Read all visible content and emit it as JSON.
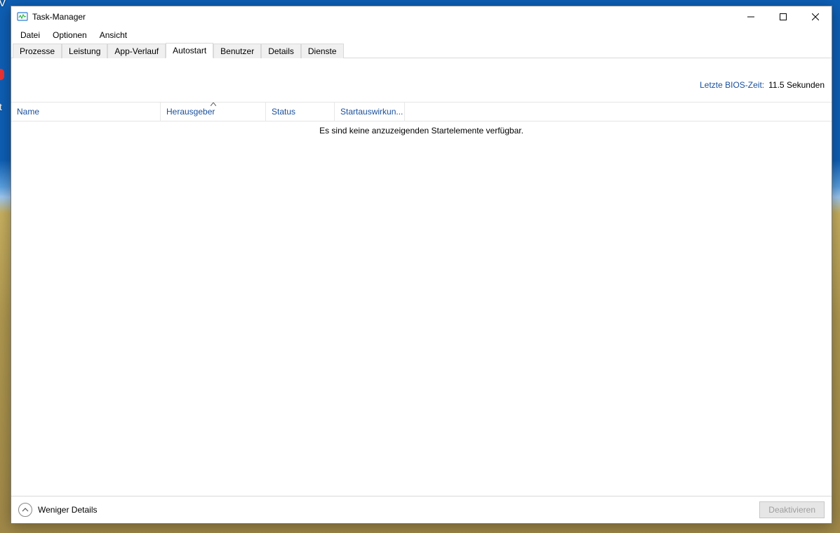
{
  "window": {
    "title": "Task-Manager"
  },
  "menu": {
    "file": "Datei",
    "options": "Optionen",
    "view": "Ansicht"
  },
  "tabs": {
    "processes": "Prozesse",
    "performance": "Leistung",
    "app_history": "App-Verlauf",
    "startup": "Autostart",
    "users": "Benutzer",
    "details": "Details",
    "services": "Dienste",
    "active": "startup"
  },
  "bios": {
    "label": "Letzte BIOS-Zeit:",
    "value": "11.5 Sekunden"
  },
  "columns": {
    "name": "Name",
    "publisher": "Herausgeber",
    "status": "Status",
    "impact": "Startauswirkun..."
  },
  "list": {
    "empty_message": "Es sind keine anzuzeigenden Startelemente verfügbar."
  },
  "footer": {
    "fewer_details": "Weniger Details",
    "disable": "Deaktivieren"
  }
}
